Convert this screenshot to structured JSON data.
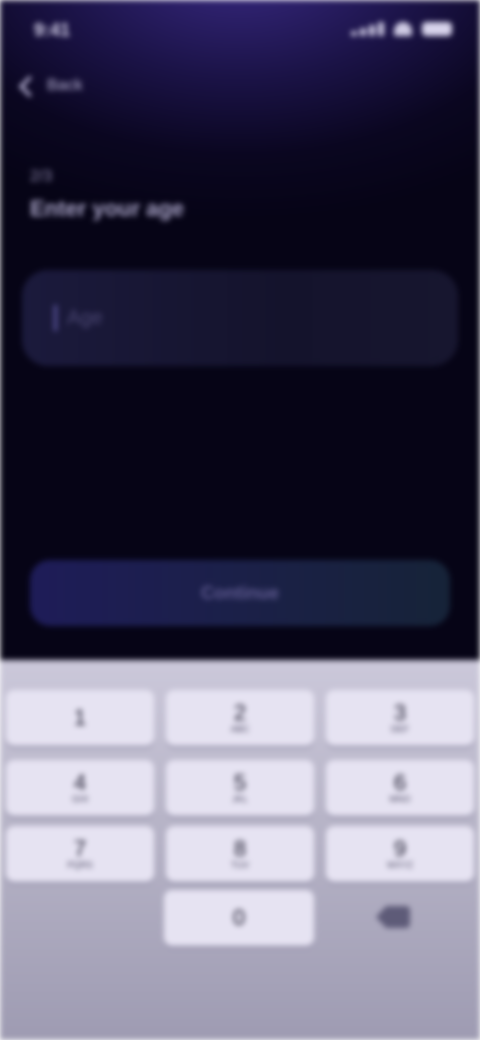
{
  "status_bar": {
    "time": "9:41"
  },
  "nav": {
    "back_label": "Back"
  },
  "header": {
    "step": "2/3",
    "title": "Enter your age"
  },
  "form": {
    "input_value": "",
    "input_placeholder": "Age"
  },
  "actions": {
    "continue_label": "Continue"
  },
  "keyboard": {
    "rows": [
      [
        {
          "d": "1",
          "s": ""
        },
        {
          "d": "2",
          "s": "ABC"
        },
        {
          "d": "3",
          "s": "DEF"
        }
      ],
      [
        {
          "d": "4",
          "s": "GHI"
        },
        {
          "d": "5",
          "s": "JKL"
        },
        {
          "d": "6",
          "s": "MNO"
        }
      ],
      [
        {
          "d": "7",
          "s": "PQRS"
        },
        {
          "d": "8",
          "s": "TUV"
        },
        {
          "d": "9",
          "s": "WXYZ"
        }
      ]
    ],
    "zero": "0"
  },
  "colors": {
    "background_top": "#3a2a86",
    "background_bottom": "#060416",
    "input_bg": "#1b1a3c",
    "button_bg": "#1e1c58",
    "keyboard_bg": "#cbc8da",
    "key_bg": "#e6e3f2"
  },
  "icons": {
    "back": "chevron-left-icon",
    "backspace": "backspace-icon"
  }
}
